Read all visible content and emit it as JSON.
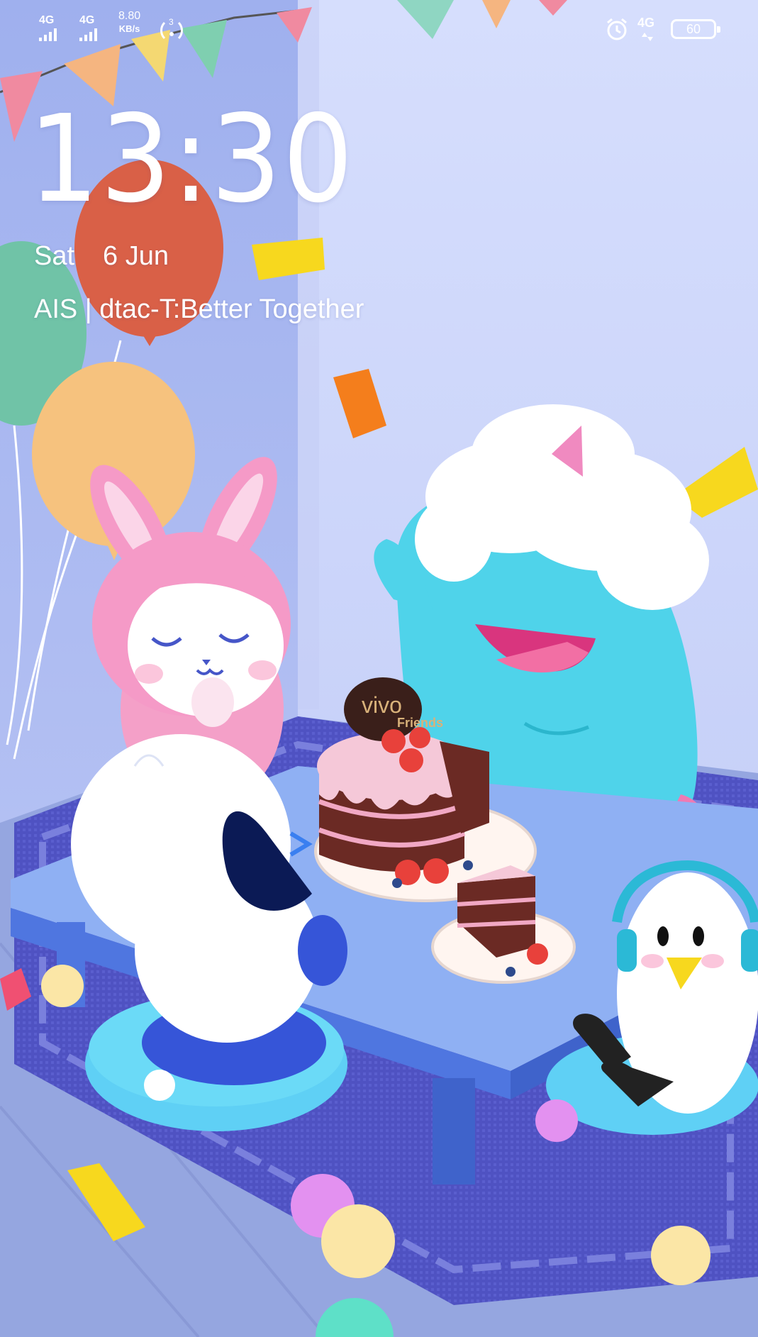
{
  "status_bar": {
    "sim1_network": "4G",
    "sim2_network": "4G",
    "net_speed_value": "8.80",
    "net_speed_unit": "KB/s",
    "hotspot_count": "3",
    "right_network": "4G",
    "battery_level": "60"
  },
  "lockscreen": {
    "time": "13:30",
    "day": "Sat",
    "date": "6 Jun",
    "carrier": "AIS | dtac-T:Better Together"
  },
  "wallpaper": {
    "cake_logo_line1": "vivo",
    "cake_logo_line2": "Friends",
    "colors": {
      "wall_left": "#aab8f1",
      "wall_right": "#d3dcfb",
      "floor": "#8fa0dd",
      "rug": "#4e52c4",
      "table": "#8fb0f3",
      "pink_character": "#f59ac7",
      "blue_character": "#4fd3ea",
      "cushion": "#62d3f3"
    }
  }
}
